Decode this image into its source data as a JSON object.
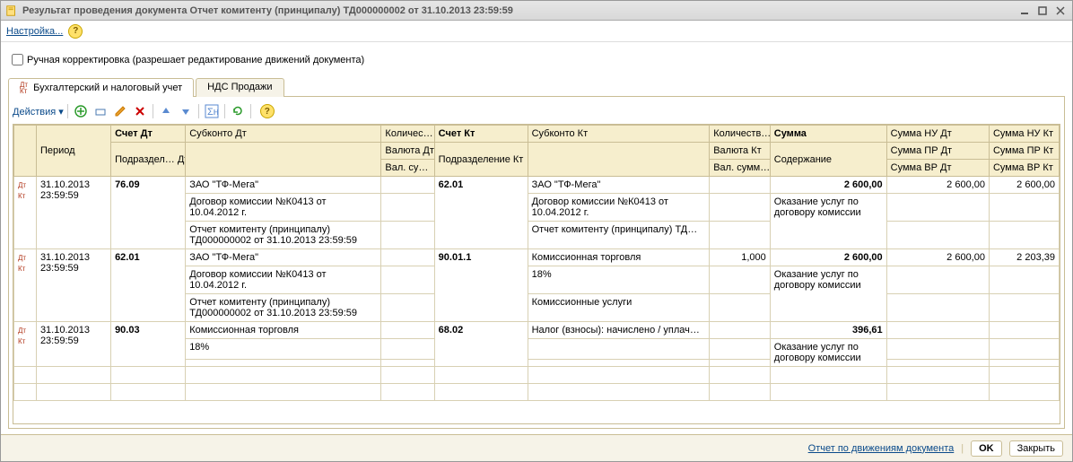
{
  "window": {
    "title": "Результат проведения документа Отчет комитенту (принципалу) ТД000000002 от 31.10.2013 23:59:59"
  },
  "menubar": {
    "settings": "Настройка..."
  },
  "checkbox_label": "Ручная корректировка (разрешает редактирование движений документа)",
  "tabs": [
    {
      "label": "Бухгалтерский и налоговый учет"
    },
    {
      "label": "НДС Продажи"
    }
  ],
  "toolbar": {
    "actions": "Действия"
  },
  "headers": {
    "period": "Период",
    "acct_dt": "Счет Дт",
    "acct_dt_dept": "Подраздел… Дт",
    "subc_dt": "Субконто Дт",
    "qty_dt": "Количес…",
    "currency_dt": "Валюта Дт",
    "valsum_dt": "Вал. су…",
    "acct_kt": "Счет Кт",
    "acct_kt_dept": "Подразделение Кт",
    "subc_kt": "Субконто Кт",
    "qty_kt": "Количеств…",
    "currency_kt": "Валюта Кт",
    "valsum_kt": "Вал. сумм…",
    "sum": "Сумма",
    "descr": "Содержание",
    "sum_nu_dt": "Сумма НУ Дт",
    "sum_pr_dt": "Сумма ПР Дт",
    "sum_vr_dt": "Сумма ВР Дт",
    "sum_nu_kt": "Сумма НУ Кт",
    "sum_pr_kt": "Сумма ПР Кт",
    "sum_vr_kt": "Сумма ВР Кт"
  },
  "rows": [
    {
      "period": "31.10.2013 23:59:59",
      "acct_dt": "76.09",
      "subc_dt": [
        "ЗАО \"ТФ-Мега\"",
        "Договор комиссии №К0413 от 10.04.2012 г.",
        "Отчет комитенту (принципалу) ТД000000002 от 31.10.2013 23:59:59"
      ],
      "acct_kt": "62.01",
      "subc_kt": [
        "ЗАО \"ТФ-Мега\"",
        "Договор комиссии №К0413 от 10.04.2012 г.",
        "Отчет комитенту (принципалу) ТД…"
      ],
      "qty_kt": "",
      "sum": "2 600,00",
      "descr": "Оказание услуг по договору комиссии",
      "sum_nu_dt": "2 600,00",
      "sum_nu_kt": "2 600,00"
    },
    {
      "period": "31.10.2013 23:59:59",
      "acct_dt": "62.01",
      "subc_dt": [
        "ЗАО \"ТФ-Мега\"",
        "Договор комиссии №К0413 от 10.04.2012 г.",
        "Отчет комитенту (принципалу) ТД000000002 от 31.10.2013 23:59:59"
      ],
      "acct_kt": "90.01.1",
      "subc_kt": [
        "Комиссионная торговля",
        "18%",
        "Комиссионные услуги"
      ],
      "qty_kt": "1,000",
      "sum": "2 600,00",
      "descr": "Оказание услуг по договору комиссии",
      "sum_nu_dt": "2 600,00",
      "sum_nu_kt": "2 203,39"
    },
    {
      "period": "31.10.2013 23:59:59",
      "acct_dt": "90.03",
      "subc_dt": [
        "Комиссионная торговля",
        "18%",
        ""
      ],
      "acct_kt": "68.02",
      "subc_kt": [
        "Налог (взносы): начислено / уплач…",
        "",
        ""
      ],
      "qty_kt": "",
      "sum": "396,61",
      "descr": "Оказание услуг по договору комиссии",
      "sum_nu_dt": "",
      "sum_nu_kt": ""
    }
  ],
  "bottom": {
    "report_link": "Отчет по движениям документа",
    "ok": "OK",
    "close": "Закрыть"
  }
}
